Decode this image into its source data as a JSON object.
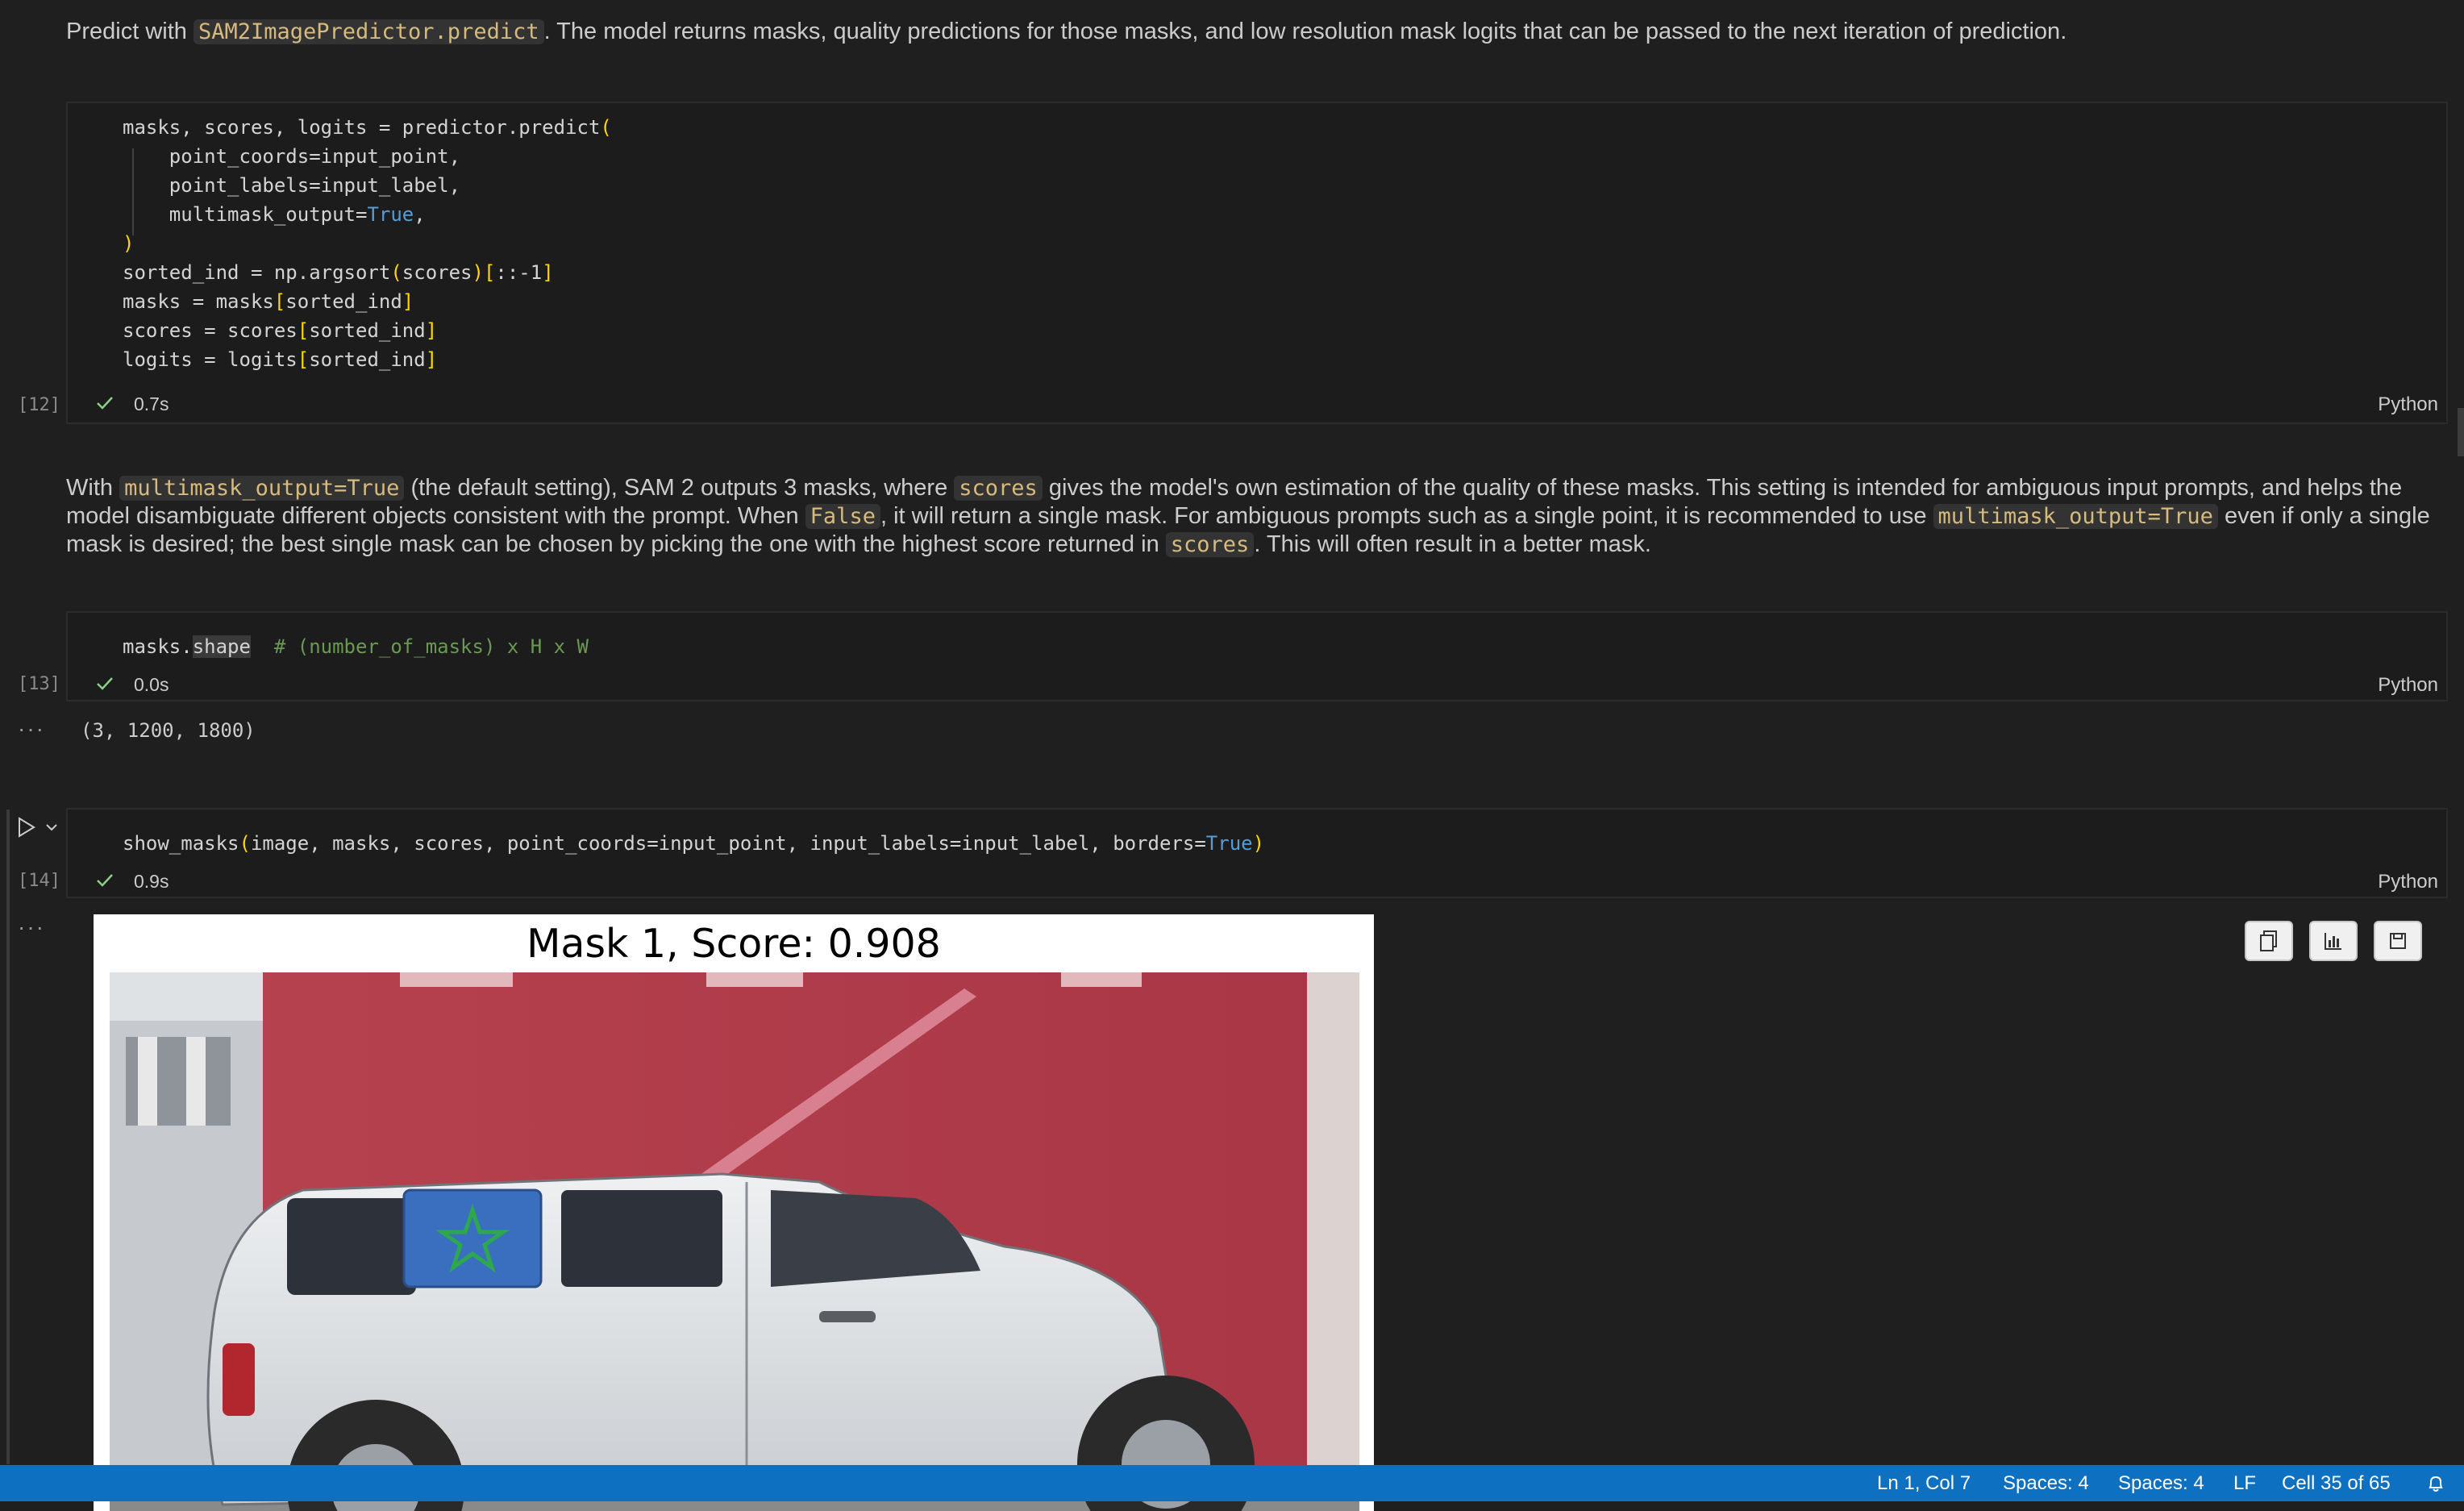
{
  "markdown1": {
    "before": "Predict with ",
    "code": "SAM2ImagePredictor.predict",
    "after": ". The model returns masks, quality predictions for those masks, and low resolution mask logits that can be passed to the next iteration of prediction."
  },
  "cell12": {
    "count": "[12]",
    "time": "0.7s",
    "lang": "Python",
    "lines": {
      "l1": "masks, scores, logits = predictor.predict",
      "l2": "point_coords=input_point,",
      "l3": "point_labels=input_label,",
      "l4": "multimask_output=",
      "l4kw": "True",
      "l6a": "sorted_ind = np.argsort",
      "l6b": "scores",
      "l6c": "::-1",
      "l7a": "masks = masks",
      "l7b": "sorted_ind",
      "l8a": "scores = scores",
      "l8b": "sorted_ind",
      "l9a": "logits = logits",
      "l9b": "sorted_ind"
    }
  },
  "markdown2": {
    "p1": "With ",
    "c1": "multimask_output=True",
    "p2": " (the default setting), SAM 2 outputs 3 masks, where ",
    "c2": "scores",
    "p3": " gives the model's own estimation of the quality of these masks. This setting is intended for ambiguous input prompts, and helps the model disambiguate different objects consistent with the prompt. When ",
    "c3": "False",
    "p4": ", it will return a single mask. For ambiguous prompts such as a single point, it is recommended to use ",
    "c4": "multimask_output=True",
    "p5": " even if only a single mask is desired; the best single mask can be chosen by picking the one with the highest score returned in ",
    "c5": "scores",
    "p6": ". This will often result in a better mask."
  },
  "cell13": {
    "count": "[13]",
    "time": "0.0s",
    "lang": "Python",
    "code_a": "masks.",
    "code_b": "shape",
    "comment": "# (number_of_masks) x H x W",
    "output": "(3, 1200, 1800)"
  },
  "cell14": {
    "count": "[14]",
    "time": "0.9s",
    "lang": "Python",
    "code_a": "show_masks",
    "code_b": "image, masks, scores, point_coords=input_point, input_labels=input_label, borders=",
    "code_kw": "True"
  },
  "figure": {
    "title": "Mask 1, Score: 0.908"
  },
  "status_bar": {
    "position": "Ln 1, Col 7",
    "spaces1": "Spaces: 4",
    "spaces2": "Spaces: 4",
    "eol": "LF",
    "cell": "Cell 35 of 65"
  },
  "colors": {
    "background": "#1f1f1f",
    "status_bar": "#0e70c0",
    "keyword": "#569cd6",
    "bracket": "#ffd700",
    "inline_code": "#d7ba7d",
    "comment": "#6a9955"
  }
}
